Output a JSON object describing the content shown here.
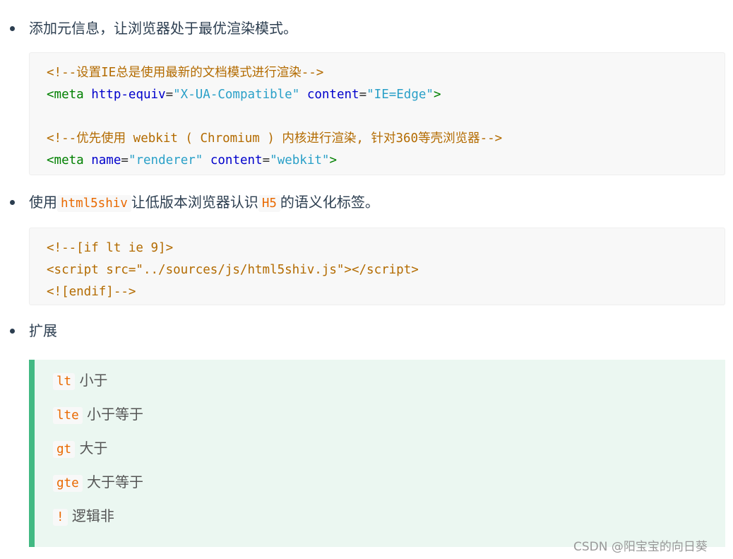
{
  "colors": {
    "accent": "#42b983",
    "inline_code": "#e96900",
    "quote_bg": "#ebf7f1"
  },
  "items": [
    {
      "text": "添加元信息，让浏览器处于最优渲染模式。"
    },
    {
      "pre": "使用",
      "code1": "html5shiv",
      "mid": "让低版本浏览器认识",
      "code2": "H5",
      "post": "的语义化标签。"
    },
    {
      "text": "扩展"
    }
  ],
  "code1": {
    "c1": "<!--设置IE总是使用最新的文档模式进行渲染-->",
    "l2": {
      "tag": "<meta",
      "a1": "http-equiv",
      "v1": "\"X-UA-Compatible\"",
      "a2": "content",
      "v2": "\"IE=Edge\"",
      "end": ">"
    },
    "c2": "<!--优先使用 webkit ( Chromium ) 内核进行渲染, 针对360等壳浏览器-->",
    "l5": {
      "tag": "<meta",
      "a1": "name",
      "v1": "\"renderer\"",
      "a2": "content",
      "v2": "\"webkit\"",
      "end": ">"
    }
  },
  "code2": {
    "lines": [
      "<!--[if lt ie 9]>",
      "<script src=\"../sources/js/html5shiv.js\"></script>",
      "<![endif]-->"
    ]
  },
  "operators": [
    {
      "code": "lt",
      "desc": "小于"
    },
    {
      "code": "lte",
      "desc": "小于等于"
    },
    {
      "code": "gt",
      "desc": "大于"
    },
    {
      "code": "gte",
      "desc": "大于等于"
    },
    {
      "code": "!",
      "desc": "逻辑非"
    }
  ],
  "watermark": "CSDN @阳宝宝的向日葵"
}
